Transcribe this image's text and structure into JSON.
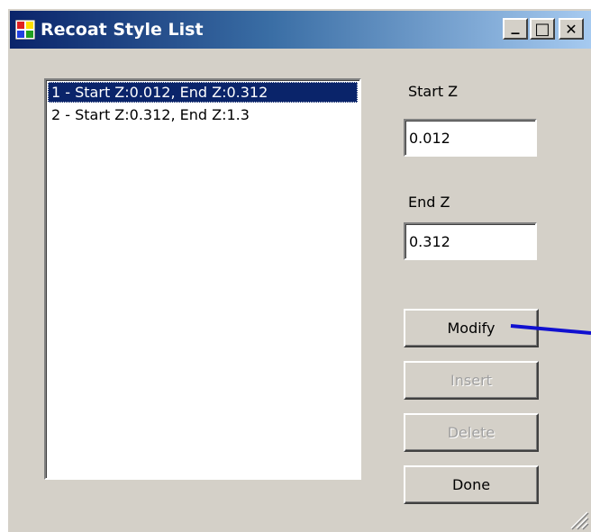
{
  "window": {
    "title": "Recoat Style List",
    "controls": {
      "minimize": "_",
      "maximize": "□",
      "close": "✕"
    }
  },
  "list": {
    "items": [
      {
        "label": "1 - Start Z:0.012, End Z:0.312",
        "selected": true
      },
      {
        "label": "2 - Start Z:0.312, End Z:1.3",
        "selected": false
      }
    ]
  },
  "fields": {
    "start_z": {
      "label": "Start Z",
      "value": "0.012"
    },
    "end_z": {
      "label": "End Z",
      "value": "0.312"
    }
  },
  "buttons": {
    "modify": {
      "label": "Modify",
      "enabled": true
    },
    "insert": {
      "label": "Insert",
      "enabled": false
    },
    "delete": {
      "label": "Delete",
      "enabled": false
    },
    "done": {
      "label": "Done",
      "enabled": true
    }
  },
  "annotation": {
    "arrow_color": "#1010d0"
  },
  "colors": {
    "selection": "#0a246a",
    "window_face": "#d4d0c8",
    "titlebar_start": "#0a246a",
    "titlebar_end": "#a6caf0"
  }
}
